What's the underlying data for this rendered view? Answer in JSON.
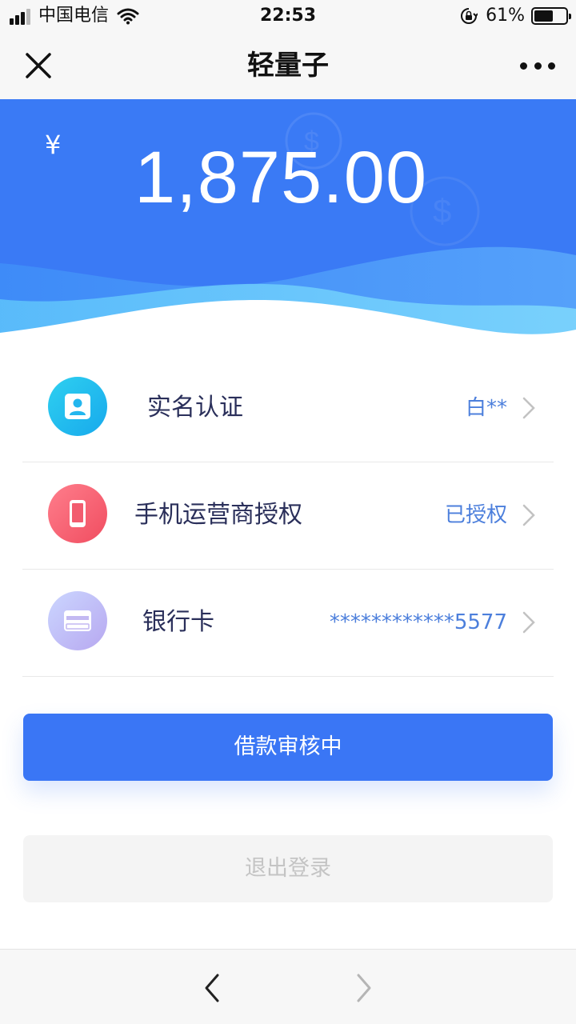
{
  "status_bar": {
    "carrier": "中国电信",
    "time": "22:53",
    "battery_percent": "61%",
    "battery_level": 0.61,
    "signal_bars_active": 3,
    "signal_bars_total": 4
  },
  "nav": {
    "title": "轻量子",
    "close_icon": "close-icon",
    "more_icon": "more-icon"
  },
  "balance": {
    "currency_symbol": "¥",
    "amount": "1,875.00"
  },
  "items": [
    {
      "label": "实名认证",
      "value": "白**",
      "icon": "id-card-icon"
    },
    {
      "label": "手机运营商授权",
      "value": "已授权",
      "icon": "phone-icon"
    },
    {
      "label": "银行卡",
      "value": "************5577",
      "icon": "bank-card-icon"
    }
  ],
  "buttons": {
    "primary": "借款审核中",
    "logout": "退出登录"
  },
  "toolbar": {
    "back_icon": "chevron-left-icon",
    "forward_icon": "chevron-right-icon"
  },
  "colors": {
    "accent": "#3a76f5",
    "value_text": "#4c7fdc",
    "label_text": "#2a2f5a"
  }
}
